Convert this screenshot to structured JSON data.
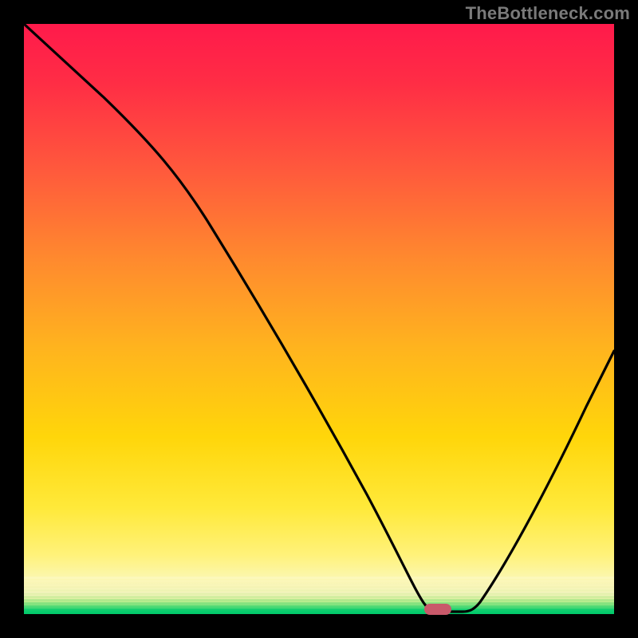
{
  "watermark": "TheBottleneck.com",
  "chart_data": {
    "type": "line",
    "title": "",
    "xlabel": "",
    "ylabel": "",
    "xlim": [
      0,
      100
    ],
    "ylim": [
      0,
      100
    ],
    "x": [
      0,
      12,
      25,
      33,
      45,
      55,
      62,
      65,
      68,
      70,
      74,
      80,
      88,
      95,
      100
    ],
    "values": [
      100,
      88,
      75,
      65,
      48,
      32,
      18,
      8,
      2,
      0.5,
      0.5,
      6,
      22,
      40,
      55
    ],
    "marker": {
      "x": 70,
      "y": 0.5
    },
    "gradient_stops": [
      {
        "pct": 0,
        "color": "#ff1a4b"
      },
      {
        "pct": 25,
        "color": "#ff5a3c"
      },
      {
        "pct": 55,
        "color": "#ffb41e"
      },
      {
        "pct": 82,
        "color": "#ffe93a"
      },
      {
        "pct": 96,
        "color": "#f7f5c4"
      },
      {
        "pct": 100,
        "color": "#00c96b"
      }
    ]
  }
}
